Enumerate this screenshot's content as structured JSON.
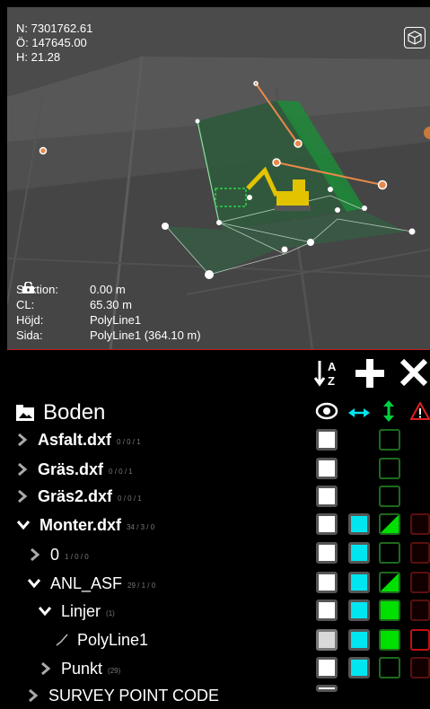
{
  "viewport": {
    "coords": {
      "n": "N: 7301762.61",
      "o": "Ö: 147645.00",
      "h": "H: 21.28"
    },
    "info": [
      {
        "label": "Sektion:",
        "value": "0.00 m",
        "locked": false
      },
      {
        "label": "CL:",
        "value": "65.30 m",
        "locked": false
      },
      {
        "label": "Höjd:",
        "value": "PolyLine1",
        "locked": true
      },
      {
        "label": "Sida:",
        "value": "PolyLine1 (364.10 m)",
        "locked": true
      }
    ]
  },
  "toolbar": {
    "sort_icon": "sort-az-icon",
    "add_icon": "plus-icon",
    "close_icon": "close-icon"
  },
  "root": {
    "title": "Boden",
    "icon": "folder-image-icon"
  },
  "columns": [
    "eye-icon",
    "horizontal-arrows-icon",
    "vertical-arrows-icon",
    "warning-icon"
  ],
  "tree": [
    {
      "name": "Asfalt.dxf",
      "count": "0 / 0 / 1",
      "bold": true,
      "chevron": "right"
    },
    {
      "name": "Gräs.dxf",
      "count": "0 / 0 / 1",
      "bold": true,
      "chevron": "right"
    },
    {
      "name": "Gräs2.dxf",
      "count": "0 / 0 / 1",
      "bold": true,
      "chevron": "right"
    },
    {
      "name": "Monter.dxf",
      "count": "34 / 3 / 0",
      "bold": true,
      "chevron": "down"
    },
    {
      "name": "0",
      "count": "1 / 0 / 0",
      "bold": false,
      "chevron": "right"
    },
    {
      "name": "ANL_ASF",
      "count": "29 / 1 / 0",
      "bold": false,
      "chevron": "down"
    },
    {
      "name": "Linjer",
      "count": "(1)",
      "bold": false,
      "chevron": "down"
    },
    {
      "name": "PolyLine1",
      "count": "",
      "bold": false,
      "chevron": "polyline"
    },
    {
      "name": "Punkt",
      "count": "(29)",
      "bold": false,
      "chevron": "right"
    },
    {
      "name": "SURVEY POINT CODE",
      "count": "",
      "bold": false,
      "chevron": "right"
    }
  ],
  "colors": {
    "accent_cyan": "#00e5f0",
    "green": "#00e000",
    "red": "#c01010"
  }
}
